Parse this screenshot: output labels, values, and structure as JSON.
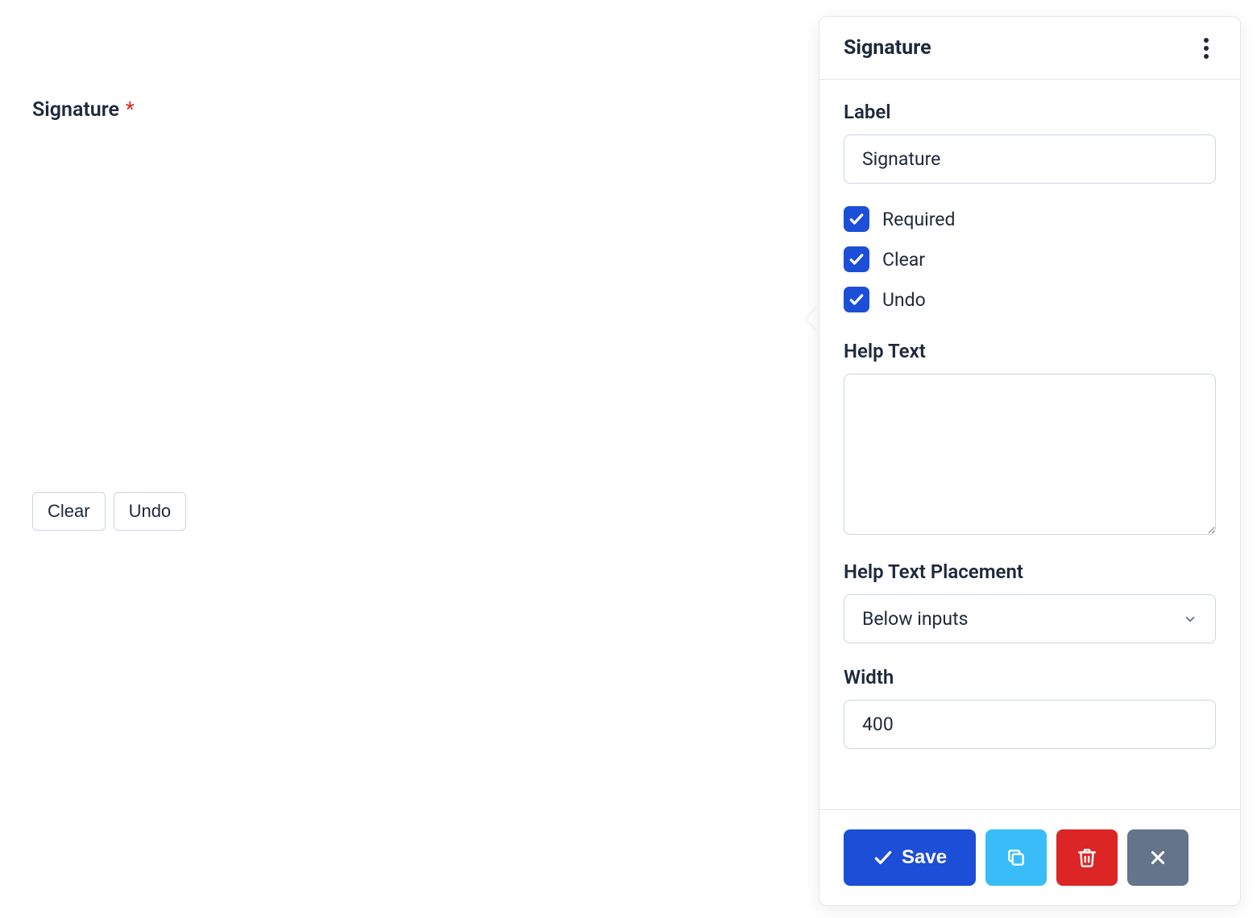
{
  "preview": {
    "field_label": "Signature",
    "required_mark": "*",
    "clear_button": "Clear",
    "undo_button": "Undo"
  },
  "panel": {
    "title": "Signature",
    "label_section": {
      "heading": "Label",
      "value": "Signature"
    },
    "checkboxes": {
      "required": "Required",
      "clear": "Clear",
      "undo": "Undo"
    },
    "help_text": {
      "heading": "Help Text",
      "value": ""
    },
    "help_placement": {
      "heading": "Help Text Placement",
      "selected": "Below inputs"
    },
    "width": {
      "heading": "Width",
      "value": "400"
    },
    "footer": {
      "save": "Save"
    }
  }
}
